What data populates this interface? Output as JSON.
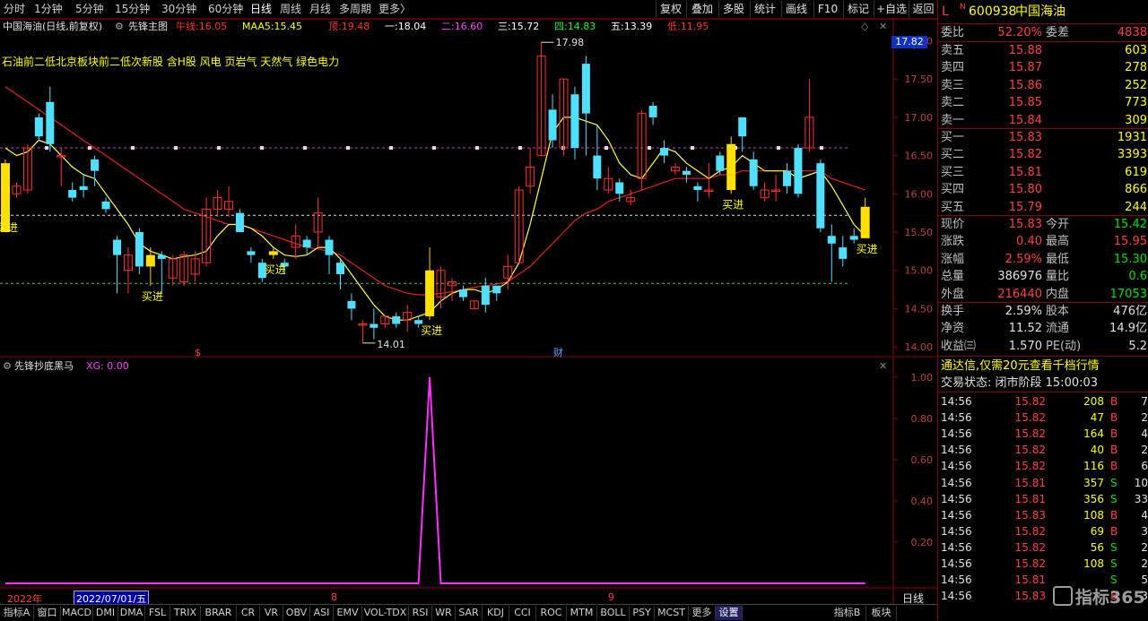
{
  "toolbar": {
    "periods": [
      "分时",
      "1分钟",
      "5分钟",
      "15分钟",
      "30分钟",
      "60分钟",
      "日线",
      "周线",
      "月线",
      "多周期",
      "更多〉"
    ],
    "active_period": "日线",
    "buttons": [
      "复权",
      "叠加",
      "多股",
      "统计",
      "画线",
      "F10",
      "标记",
      "+自选",
      "返回"
    ]
  },
  "chart_header": {
    "title": "中国海油(日线,前复权)",
    "indicator": "先锋主图",
    "items": [
      {
        "label": "牛线:",
        "value": "16.05",
        "color": "#ff3030"
      },
      {
        "label": "MAA5:",
        "value": "15.45",
        "color": "#ffff00"
      },
      {
        "label": "顶:",
        "value": "19.48",
        "color": "#ff3030"
      },
      {
        "label": "一:",
        "value": "18.04",
        "color": "#ffffff"
      },
      {
        "label": "二:",
        "value": "16.60",
        "color": "#ff40ff"
      },
      {
        "label": "三:",
        "value": "15.72",
        "color": "#ffffff"
      },
      {
        "label": "四:",
        "value": "14.83",
        "color": "#00ff00"
      },
      {
        "label": "五:",
        "value": "13.39",
        "color": "#ffffff"
      },
      {
        "label": "低:",
        "value": "11.95",
        "color": "#ff3030"
      }
    ],
    "concept_text": "石油前二低北京板块前二低次新股 含H股 风电 页岩气 天然气 绿色电力",
    "current_price_tag": "17.82",
    "high_label": "17.98",
    "low_label": "14.01",
    "markers": {
      "s": "$",
      "cai": "财"
    },
    "buy_label": "买进"
  },
  "sub_header": {
    "indicator": "先锋抄底黑马",
    "xg": "XG: 0.00"
  },
  "price_axis": [
    "18.00",
    "17.50",
    "17.00",
    "16.50",
    "16.00",
    "15.50",
    "15.00",
    "14.50",
    "14.00"
  ],
  "sub_axis": [
    "1.00",
    "0.80",
    "0.60",
    "0.40",
    "0.20"
  ],
  "time_axis": {
    "year": "2022年",
    "date": "2022/07/01/五",
    "m8": "8",
    "m9": "9",
    "period": "日线"
  },
  "candles": [
    [
      15.5,
      16.4,
      15.7,
      16.45
    ],
    [
      16.0,
      16.1,
      15.95,
      16.15
    ],
    [
      16.05,
      16.6,
      16.0,
      16.65
    ],
    [
      17.0,
      16.75,
      16.7,
      17.05
    ],
    [
      17.2,
      16.65,
      16.55,
      17.4
    ],
    [
      16.5,
      16.5,
      16.1,
      16.6
    ],
    [
      16.05,
      15.95,
      15.9,
      16.15
    ],
    [
      16.1,
      16.05,
      15.95,
      16.25
    ],
    [
      16.45,
      16.3,
      16.1,
      16.5
    ],
    [
      15.9,
      15.8,
      15.75,
      15.95
    ],
    [
      15.4,
      15.2,
      14.7,
      15.45
    ],
    [
      15.0,
      15.2,
      14.7,
      15.3
    ],
    [
      15.5,
      15.05,
      14.95,
      15.55
    ],
    [
      15.05,
      15.2,
      14.8,
      15.3
    ],
    [
      15.2,
      15.15,
      14.7,
      15.25
    ],
    [
      14.9,
      15.15,
      14.8,
      15.2
    ],
    [
      14.85,
      15.2,
      14.8,
      15.25
    ],
    [
      14.95,
      15.15,
      14.85,
      15.25
    ],
    [
      15.1,
      15.8,
      15.05,
      15.95
    ],
    [
      15.8,
      15.95,
      15.7,
      16.05
    ],
    [
      15.8,
      15.9,
      15.7,
      16.1
    ],
    [
      15.75,
      15.5,
      15.5,
      15.8
    ],
    [
      15.25,
      15.2,
      15.1,
      15.3
    ],
    [
      15.1,
      14.9,
      14.85,
      15.15
    ],
    [
      15.2,
      15.25,
      15.15,
      15.3
    ],
    [
      15.1,
      15.05,
      14.95,
      15.15
    ],
    [
      15.3,
      15.45,
      15.15,
      15.6
    ],
    [
      15.4,
      15.3,
      15.2,
      15.45
    ],
    [
      15.5,
      15.75,
      15.3,
      15.95
    ],
    [
      15.4,
      15.2,
      14.95,
      15.45
    ],
    [
      15.1,
      14.95,
      14.75,
      15.15
    ],
    [
      14.6,
      14.5,
      14.35,
      14.7
    ],
    [
      14.3,
      14.3,
      14.05,
      14.35
    ],
    [
      14.3,
      14.25,
      14.1,
      14.5
    ],
    [
      14.3,
      14.4,
      14.25,
      14.4
    ],
    [
      14.4,
      14.3,
      14.25,
      14.45
    ],
    [
      14.35,
      14.45,
      14.2,
      14.55
    ],
    [
      14.35,
      14.3,
      14.25,
      14.4
    ],
    [
      14.4,
      15.0,
      14.35,
      15.3
    ],
    [
      14.65,
      15.0,
      14.5,
      15.05
    ],
    [
      14.8,
      14.85,
      14.6,
      14.9
    ],
    [
      14.75,
      14.65,
      14.6,
      14.8
    ],
    [
      14.5,
      14.6,
      14.5,
      14.6
    ],
    [
      14.8,
      14.55,
      14.45,
      14.9
    ],
    [
      14.8,
      14.7,
      14.6,
      14.8
    ],
    [
      14.9,
      15.05,
      14.75,
      15.2
    ],
    [
      15.1,
      16.05,
      15.1,
      16.1
    ],
    [
      16.1,
      16.35,
      16.0,
      16.6
    ],
    [
      16.5,
      17.8,
      16.5,
      17.98
    ],
    [
      17.1,
      16.7,
      16.6,
      17.3
    ],
    [
      16.6,
      17.5,
      16.5,
      17.5
    ],
    [
      17.3,
      16.6,
      16.45,
      17.4
    ],
    [
      17.7,
      17.05,
      16.5,
      17.8
    ],
    [
      16.5,
      16.2,
      16.05,
      16.9
    ],
    [
      16.05,
      16.2,
      16.0,
      16.35
    ],
    [
      16.15,
      16.0,
      15.9,
      16.2
    ],
    [
      15.9,
      15.95,
      15.85,
      16.05
    ],
    [
      16.2,
      17.05,
      16.05,
      17.1
    ],
    [
      17.15,
      17.0,
      16.9,
      17.2
    ],
    [
      16.6,
      16.5,
      16.4,
      16.7
    ],
    [
      16.3,
      16.35,
      16.25,
      16.4
    ],
    [
      16.3,
      16.25,
      16.15,
      16.35
    ],
    [
      16.1,
      16.05,
      15.9,
      16.15
    ],
    [
      16.05,
      16.05,
      15.95,
      16.4
    ],
    [
      16.5,
      16.3,
      16.25,
      16.55
    ],
    [
      16.65,
      16.05,
      16.0,
      16.75
    ],
    [
      17.0,
      16.75,
      16.55,
      17.0
    ],
    [
      16.45,
      16.1,
      16.05,
      16.55
    ],
    [
      15.95,
      16.05,
      15.9,
      16.15
    ],
    [
      16.05,
      16.05,
      15.9,
      16.25
    ],
    [
      16.3,
      16.1,
      16.0,
      16.4
    ],
    [
      16.6,
      16.0,
      15.95,
      16.65
    ],
    [
      16.6,
      17.0,
      16.55,
      17.5
    ],
    [
      16.4,
      15.55,
      15.5,
      16.45
    ],
    [
      15.45,
      15.35,
      14.85,
      15.6
    ],
    [
      15.3,
      15.15,
      15.05,
      15.45
    ],
    [
      15.45,
      15.4,
      15.35,
      15.55
    ],
    [
      15.42,
      15.83,
      15.42,
      15.95
    ]
  ],
  "ma5": [
    16.6,
    16.5,
    16.55,
    16.7,
    16.65,
    16.5,
    16.35,
    16.25,
    16.2,
    16.0,
    15.8,
    15.6,
    15.35,
    15.25,
    15.2,
    15.15,
    15.18,
    15.2,
    15.25,
    15.45,
    15.6,
    15.6,
    15.55,
    15.45,
    15.3,
    15.2,
    15.18,
    15.2,
    15.3,
    15.3,
    15.15,
    14.95,
    14.75,
    14.55,
    14.4,
    14.35,
    14.35,
    14.4,
    14.45,
    14.6,
    14.7,
    14.75,
    14.75,
    14.7,
    14.75,
    14.85,
    15.1,
    15.6,
    16.2,
    16.8,
    17.0,
    17.0,
    16.95,
    16.9,
    16.7,
    16.4,
    16.25,
    16.2,
    16.4,
    16.6,
    16.55,
    16.4,
    16.3,
    16.2,
    16.3,
    16.35,
    16.5,
    16.4,
    16.3,
    16.3,
    16.3,
    16.2,
    16.25,
    16.3,
    16.1,
    15.85,
    15.6,
    15.45
  ],
  "ma_red": [
    17.4,
    17.3,
    17.2,
    17.1,
    17.0,
    16.9,
    16.8,
    16.7,
    16.6,
    16.5,
    16.4,
    16.3,
    16.2,
    16.1,
    16.0,
    15.9,
    15.8,
    15.75,
    15.7,
    15.65,
    15.6,
    15.6,
    15.55,
    15.5,
    15.45,
    15.4,
    15.35,
    15.3,
    15.28,
    15.25,
    15.2,
    15.1,
    15.0,
    14.9,
    14.8,
    14.75,
    14.7,
    14.68,
    14.68,
    14.7,
    14.72,
    14.75,
    14.78,
    14.8,
    14.82,
    14.85,
    14.95,
    15.05,
    15.2,
    15.35,
    15.5,
    15.65,
    15.75,
    15.8,
    15.9,
    15.95,
    16.0,
    16.05,
    16.1,
    16.15,
    16.2,
    16.2,
    16.2,
    16.2,
    16.25,
    16.25,
    16.3,
    16.3,
    16.3,
    16.3,
    16.3,
    16.3,
    16.3,
    16.3,
    16.2,
    16.15,
    16.1,
    16.05
  ],
  "buy_points": [
    {
      "i": 0,
      "label": "买进"
    },
    {
      "i": 13,
      "label": "买进"
    },
    {
      "i": 24,
      "label": "买进"
    },
    {
      "i": 38,
      "label": "买进"
    },
    {
      "i": 65,
      "label": "买进"
    },
    {
      "i": 77,
      "label": "买进"
    }
  ],
  "right_panel": {
    "code": "600938",
    "name": "中国海油",
    "l_flag": "L",
    "n_flag": "N",
    "weibi": {
      "label": "委比",
      "value": "52.20%",
      "label2": "委差",
      "value2": "4838"
    },
    "asks": [
      {
        "label": "卖五",
        "price": "15.88",
        "vol": "603"
      },
      {
        "label": "卖四",
        "price": "15.87",
        "vol": "278"
      },
      {
        "label": "卖三",
        "price": "15.86",
        "vol": "252"
      },
      {
        "label": "卖二",
        "price": "15.85",
        "vol": "773"
      },
      {
        "label": "卖一",
        "price": "15.84",
        "vol": "309"
      }
    ],
    "bids": [
      {
        "label": "买一",
        "price": "15.83",
        "vol": "1931"
      },
      {
        "label": "买二",
        "price": "15.82",
        "vol": "3393"
      },
      {
        "label": "买三",
        "price": "15.81",
        "vol": "619"
      },
      {
        "label": "买四",
        "price": "15.80",
        "vol": "866"
      },
      {
        "label": "买五",
        "price": "15.79",
        "vol": "244"
      }
    ],
    "stats": [
      {
        "l1": "现价",
        "v1": "15.83",
        "c1": "red",
        "l2": "今开",
        "v2": "15.42",
        "c2": "green"
      },
      {
        "l1": "涨跌",
        "v1": "0.40",
        "c1": "red",
        "l2": "最高",
        "v2": "15.95",
        "c2": "red"
      },
      {
        "l1": "涨幅",
        "v1": "2.59%",
        "c1": "red",
        "l2": "最低",
        "v2": "15.30",
        "c2": "green"
      },
      {
        "l1": "总量",
        "v1": "386976",
        "c1": "white",
        "l2": "量比",
        "v2": "0.6",
        "c2": "green"
      },
      {
        "l1": "外盘",
        "v1": "216440",
        "c1": "red",
        "l2": "内盘",
        "v2": "17053",
        "c2": "green"
      }
    ],
    "stats2": [
      {
        "l1": "换手",
        "v1": "2.59%",
        "l2": "股本",
        "v2": "476亿"
      },
      {
        "l1": "净资",
        "v1": "11.52",
        "l2": "流通",
        "v2": "14.9亿"
      },
      {
        "l1": "收益㈢",
        "v1": "1.570",
        "l2": "PE(动)",
        "v2": "5.2"
      }
    ],
    "promo": "通达信,仅需20元查看千档行情",
    "trade_status": "交易状态: 闭市阶段 15:00:03",
    "ticks": [
      {
        "t": "14:56",
        "p": "15.82",
        "v": "208",
        "s": "B",
        "n": "7"
      },
      {
        "t": "14:56",
        "p": "15.82",
        "v": "47",
        "s": "B",
        "n": "2"
      },
      {
        "t": "14:56",
        "p": "15.82",
        "v": "164",
        "s": "B",
        "n": "4"
      },
      {
        "t": "14:56",
        "p": "15.82",
        "v": "40",
        "s": "B",
        "n": "2"
      },
      {
        "t": "14:56",
        "p": "15.82",
        "v": "116",
        "s": "B",
        "n": "6"
      },
      {
        "t": "14:56",
        "p": "15.81",
        "v": "357",
        "s": "S",
        "n": "10"
      },
      {
        "t": "14:56",
        "p": "15.81",
        "v": "356",
        "s": "S",
        "n": "33"
      },
      {
        "t": "14:56",
        "p": "15.83",
        "v": "108",
        "s": "B",
        "n": "4"
      },
      {
        "t": "14:56",
        "p": "15.82",
        "v": "69",
        "s": "B",
        "n": "3"
      },
      {
        "t": "14:56",
        "p": "15.82",
        "v": "56",
        "s": "S",
        "n": "2"
      },
      {
        "t": "14:56",
        "p": "15.82",
        "v": "108",
        "s": "S",
        "n": "2"
      },
      {
        "t": "14:56",
        "p": "15.81",
        "v": "",
        "s": "S",
        "n": "5"
      },
      {
        "t": "14:56",
        "p": "15.83",
        "v": "",
        "s": "B",
        "n": "3"
      }
    ],
    "watermark": "指标365"
  },
  "bottom_tabs": [
    "指标A",
    "窗口",
    "MACD",
    "DMI",
    "DMA",
    "FSL",
    "TRIX",
    "BRAR",
    "CR",
    "VR",
    "OBV",
    "ASI",
    "EMV",
    "VOL-TDX",
    "RSI",
    "WR",
    "SAR",
    "KDJ",
    "CCI",
    "ROC",
    "MTM",
    "BOLL",
    "PSY",
    "MCST",
    "更多",
    "设置",
    "指标B",
    "板块"
  ]
}
